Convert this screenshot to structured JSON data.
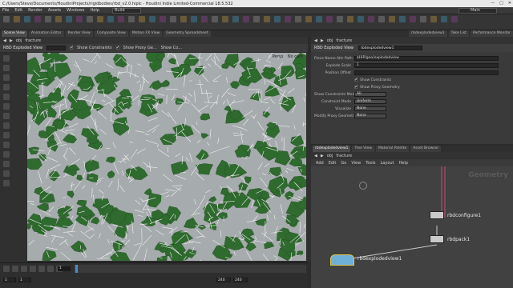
{
  "window": {
    "title": "C:/Users/Steve/Documents/HoudiniProjects/rigidbodies/rbd_v2.0.hiplc - Houdini Indie Limited-Commercial 18.5.532"
  },
  "menu": [
    "File",
    "Edit",
    "Render",
    "Assets",
    "Windows",
    "Help"
  ],
  "desktop_select": "Build",
  "main_select": "Main",
  "shelf_tabs": [
    "Create",
    "Modify",
    "Model",
    "Polygon",
    "Deform",
    "Texture",
    "Rigging",
    "Characters",
    "Constraints",
    "Hair Utils",
    "Guide Process",
    "Terrain FX",
    "Simple FX",
    "Volume",
    "Lights",
    "Collisions",
    "Particles",
    "Grains",
    "Vellum",
    "Rigid Bodies",
    "Particle Fluids",
    "Viscous Fluids",
    "Oceans",
    "Pyro FX",
    "FEM",
    "Wires",
    "Crowds",
    "Drive Simula"
  ],
  "left_pane_tabs": [
    "Scene View",
    "Animation Editor",
    "Render View",
    "Composite View",
    "Motion FX View",
    "Geometry Spreadsheet"
  ],
  "vp_path": [
    "obj",
    "fracture"
  ],
  "vp_toolbar": {
    "node_label": "RBD Exploded View",
    "show_constraints": "Show Constraints",
    "show_proxy": "Show Proxy Ge...",
    "show_co": "Show Co..."
  },
  "viewport": {
    "view_label": "Persp",
    "cam_label": "No cam",
    "node_bottom": "rbdexplodedview1"
  },
  "timeline": {
    "frame": "1",
    "start": "1",
    "end": "240",
    "end2": "240",
    "keys": "0 keys, 0/0 channels",
    "key_all": "Key All Channels",
    "auto_update": "Auto Update"
  },
  "param": {
    "tabs": [
      "rbdexplodedview1",
      "Take List",
      "Performance Monitor"
    ],
    "path": [
      "obj",
      "fracture"
    ],
    "node_type": "RBD Exploded View",
    "node_name": "rbdexplodedview1",
    "rows": [
      {
        "label": "Piece Name Attr Path",
        "value": "$HIP/geo/explodedview"
      },
      {
        "label": "Explode Scale",
        "value": "1"
      },
      {
        "label": "Position Offset",
        "value": ""
      }
    ],
    "checks": [
      {
        "label": "Show Constraints",
        "on": true
      },
      {
        "label": "Show Proxy Geometry",
        "on": true
      }
    ],
    "dropdowns": [
      {
        "label": "Show Constraints Mode",
        "value": "All"
      },
      {
        "label": "Constraint Mode",
        "value": "Uniform"
      },
      {
        "label": "Visualize",
        "value": "None"
      },
      {
        "label": "Modify Proxy Geometry",
        "value": "None"
      }
    ]
  },
  "net": {
    "tabs": [
      "rbdexplodedview1",
      "Tree View",
      "Material Palette",
      "Asset Browser"
    ],
    "path": [
      "obj",
      "fracture"
    ],
    "menu": [
      "Add",
      "Edit",
      "Go",
      "View",
      "Tools",
      "Layout",
      "Help"
    ],
    "watermark": "Geometry",
    "nodes": {
      "configure": "rbdconfigure1",
      "pack": "rbdpack1",
      "exploded": "rbdexplodedview1"
    }
  },
  "colors": {
    "leaf": "#2f6a2f",
    "highlight": "#e8c34a",
    "vp_bg": "#9aa0a2"
  }
}
